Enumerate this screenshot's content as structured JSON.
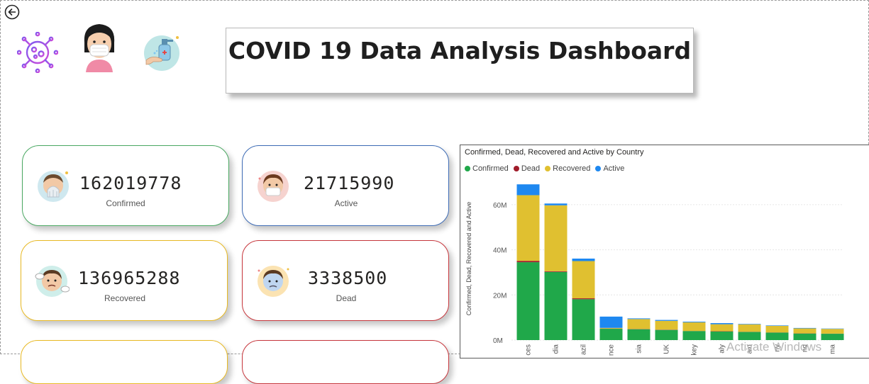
{
  "title": "COVID 19 Data Analysis Dashboard",
  "header_icons": [
    "virus-icon",
    "masked-girl-icon",
    "hand-sanitizer-icon"
  ],
  "kpis": [
    {
      "id": "confirmed",
      "value": "162019778",
      "label": "Confirmed",
      "border": "#4aa862"
    },
    {
      "id": "active",
      "value": "21715990",
      "label": "Active",
      "border": "#3d6bb5"
    },
    {
      "id": "recovered",
      "value": "136965288",
      "label": "Recovered",
      "border": "#e8b923"
    },
    {
      "id": "dead",
      "value": "3338500",
      "label": "Dead",
      "border": "#c6363c"
    }
  ],
  "colors": {
    "confirmed": "#20a84a",
    "dead": "#a01c2a",
    "recovered": "#e0c030",
    "active": "#1e88f0"
  },
  "chart_data": {
    "type": "bar",
    "stacked": true,
    "title": "Confirmed, Dead, Recovered and Active by Country",
    "ylabel": "Confirmed, Dead, Recovered and Active",
    "ylim": [
      0,
      70000000
    ],
    "yticks": [
      "0M",
      "20M",
      "40M",
      "60M"
    ],
    "ytick_values": [
      0,
      20000000,
      40000000,
      60000000
    ],
    "categories": [
      "ces",
      "dia",
      "azil",
      "nce",
      "sia",
      "UK",
      "key",
      "aly",
      "ain",
      "ny",
      "nd",
      "ma"
    ],
    "series": [
      {
        "name": "Confirmed",
        "values": [
          34500000,
          30200000,
          18100000,
          5000000,
          4800000,
          4500000,
          4000000,
          3800000,
          3600000,
          3300000,
          2900000,
          2800000
        ]
      },
      {
        "name": "Dead",
        "values": [
          600000,
          300000,
          400000,
          100000,
          110000,
          120000,
          40000,
          120000,
          80000,
          80000,
          70000,
          60000
        ]
      },
      {
        "name": "Recovered",
        "values": [
          29100000,
          29200000,
          16500000,
          300000,
          4400000,
          3900000,
          3800000,
          3100000,
          3300000,
          2900000,
          2200000,
          2100000
        ]
      },
      {
        "name": "Active",
        "values": [
          4800000,
          800000,
          1100000,
          5000000,
          300000,
          400000,
          300000,
          500000,
          200000,
          200000,
          200000,
          150000
        ]
      }
    ],
    "legend_position": "top-left"
  },
  "watermark": "Activate Windows"
}
